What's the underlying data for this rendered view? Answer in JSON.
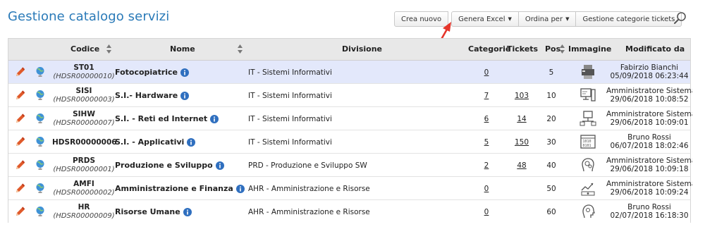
{
  "page": {
    "title": "Gestione catalogo servizi"
  },
  "toolbar": {
    "create": "Crea nuovo",
    "excel": "Genera Excel",
    "order": "Ordina per",
    "categories": "Gestione categorie tickets"
  },
  "table": {
    "headers": {
      "code": "Codice",
      "name": "Nome",
      "division": "Divisione",
      "categories": "Categorie",
      "tickets": "Tickets",
      "pos": "Pos",
      "image": "Immagine",
      "modified": "Modificato da"
    },
    "rows": [
      {
        "code": "ST01",
        "subcode": "(HDSR00000010)",
        "name": "Fotocopiatrice",
        "division": "IT - Sistemi Informativi",
        "categories": "0",
        "tickets": "",
        "pos": "5",
        "image_icon": "printer-icon",
        "mod_user": "Fabirzio Bianchi",
        "mod_date": "05/09/2018 06:23:44"
      },
      {
        "code": "SISI",
        "subcode": "(HDSR00000003)",
        "name": "S.I.- Hardware",
        "division": "IT - Sistemi Informativi",
        "categories": "7",
        "tickets": "103",
        "pos": "10",
        "image_icon": "desktop-pc-icon",
        "mod_user": "Amministratore Sistema",
        "mod_date": "29/06/2018 10:08:52"
      },
      {
        "code": "SIHW",
        "subcode": "(HDSR00000007)",
        "name": "S.I. - Reti ed Internet",
        "division": "IT - Sistemi Informativi",
        "categories": "6",
        "tickets": "14",
        "pos": "20",
        "image_icon": "network-icon",
        "mod_user": "Amministratore Sistema",
        "mod_date": "29/06/2018 10:09:01"
      },
      {
        "code": "HDSR00000006",
        "subcode": "",
        "name": "S.I. - Applicativi",
        "division": "IT - Sistemi Informativi",
        "categories": "5",
        "tickets": "150",
        "pos": "30",
        "image_icon": "binary-window-icon",
        "mod_user": "Bruno Rossi",
        "mod_date": "06/07/2018 18:02:46"
      },
      {
        "code": "PRDS",
        "subcode": "(HDSR00000001)",
        "name": "Produzione e Sviluppo",
        "division": "PRD - Produzione e Sviluppo SW",
        "categories": "2",
        "tickets": "48",
        "pos": "40",
        "image_icon": "head-gears-icon",
        "mod_user": "Amministratore Sistema",
        "mod_date": "29/06/2018 10:09:18"
      },
      {
        "code": "AMFI",
        "subcode": "(HDSR00000002)",
        "name": "Amministrazione e Finanza",
        "division": "AHR - Amministrazione e Risorse",
        "categories": "0",
        "tickets": "",
        "pos": "50",
        "image_icon": "finance-chart-icon",
        "mod_user": "Amministratore Sistema",
        "mod_date": "29/06/2018 10:09:24"
      },
      {
        "code": "HR",
        "subcode": "(HDSR00000009)",
        "name": "Risorse Umane",
        "division": "AHR - Amministrazione e Risorse",
        "categories": "0",
        "tickets": "",
        "pos": "60",
        "image_icon": "head-profile-icon",
        "mod_user": "Bruno Rossi",
        "mod_date": "02/07/2018 16:18:30"
      }
    ]
  },
  "colors": {
    "title": "#2a7ab8",
    "selected_row": "#e3e8fb",
    "arrow": "#e5352a",
    "edit": "#e05a2b",
    "info": "#2f6fbf"
  }
}
